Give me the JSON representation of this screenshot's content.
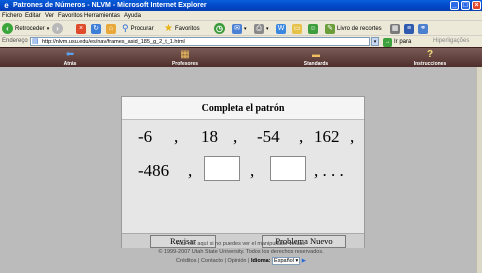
{
  "window": {
    "title": "Patrones de Números - NLVM - Microsoft Internet Explorer",
    "controls": [
      "_",
      "□",
      "×"
    ]
  },
  "menu": [
    "Fichero",
    "Editar",
    "Ver",
    "Favoritos",
    "Herramientas",
    "Ayuda"
  ],
  "toolbar": {
    "back_label": "Retroceder",
    "search_label": "Procurar",
    "favorites_label": "Favoritos",
    "feeds_label": "Livro de recortes"
  },
  "address": {
    "label": "Endereço",
    "url": "http://nlvm.usu.edu/es/nav/frames_asid_185_g_2_t_1.html",
    "go_label": "Ir para",
    "links_label": "Hiperligações"
  },
  "nav": [
    {
      "icon": "back-arrow-icon",
      "label": "Atrás"
    },
    {
      "icon": "teacher-icon",
      "label": "Profesores"
    },
    {
      "icon": "standards-icon",
      "label": "Standards"
    },
    {
      "icon": "question-icon",
      "label": "Instrucciones"
    }
  ],
  "panel": {
    "title": "Completa el patrón",
    "row1": [
      "-6",
      ",",
      "18",
      ",",
      "-54",
      ",",
      "162",
      ","
    ],
    "row2_first": "-486",
    "row2_comma1": ",",
    "row2_comma2": ",",
    "row2_tail": ", . . .",
    "check_button": "Revisar",
    "new_button": "Problema Nuevo"
  },
  "footer": {
    "line1": "Haz clic aquí si no puedes ver el manipulador virtual.",
    "line2": "© 1999-2007 Utah State University. Todos los derechos reservados.",
    "links": "Créditos | Contacto | Opinión |",
    "language_label": "Idioma:",
    "language_value": "Español"
  },
  "colors": {
    "title_bar": "#0A5EDB",
    "nav_bar": "#5A3A36",
    "content_bg": "#BBBBBB",
    "panel_bg": "#E6E6E6"
  }
}
